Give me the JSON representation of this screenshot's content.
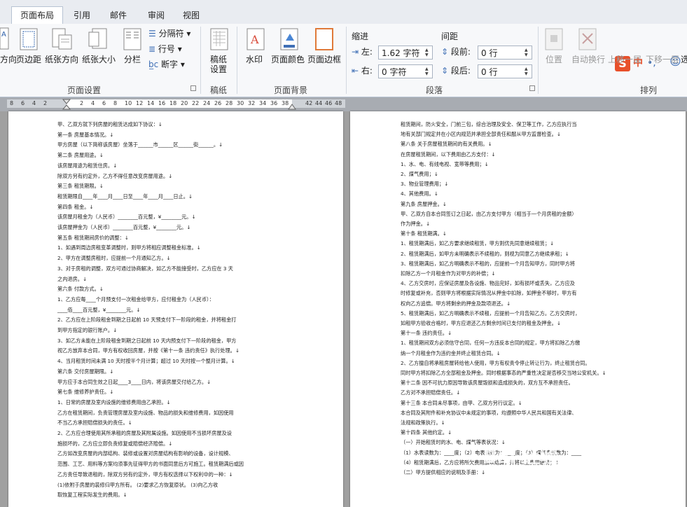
{
  "tabs": [
    {
      "label": "页面布局",
      "active": true
    },
    {
      "label": "引用"
    },
    {
      "label": "邮件"
    },
    {
      "label": "审阅"
    },
    {
      "label": "视图"
    }
  ],
  "page_setup": {
    "direction": "方向",
    "margins": "页边距",
    "orientation": "纸张方向",
    "size": "纸张大小",
    "columns": "分栏",
    "breaks": "分隔符",
    "line_numbers": "行号",
    "hyphenation": "断字",
    "group_label": "页面设置"
  },
  "manuscript": {
    "button": "稿纸\n设置",
    "group_label": "稿纸"
  },
  "background": {
    "watermark": "水印",
    "page_color": "页面颜色",
    "page_border": "页面边框",
    "group_label": "页面背景"
  },
  "paragraph": {
    "indent_title": "缩进",
    "left_label": "左:",
    "left_value": "1.62 字符",
    "right_label": "右:",
    "right_value": "0 字符",
    "spacing_title": "间距",
    "before_label": "段前:",
    "before_value": "0 行",
    "after_label": "段后:",
    "after_value": "0 行",
    "group_label": "段落"
  },
  "arrange": {
    "position": "位置",
    "wrap": "自动换行",
    "bring_forward": "上移一层",
    "send_backward": "下移一层",
    "cut_label": "选",
    "group_label": "排列"
  },
  "ime": {
    "s": "S",
    "zh": "中",
    "p": "•,",
    "smile": "☺"
  },
  "ruler_numbers": [
    "8",
    "6",
    "4",
    "2",
    "2",
    "4",
    "6",
    "8",
    "10",
    "12",
    "14",
    "16",
    "18",
    "20",
    "22",
    "24",
    "26",
    "28",
    "30",
    "32",
    "34",
    "36",
    "38",
    "42",
    "44",
    "46",
    "48"
  ],
  "left_page_lines": [
    "甲、乙双方就下列房屋的租赁达成如下协议：↓",
    "第一条  房屋基本情况。↓",
    "甲方房屋（以下简称该房屋）坐落于______市______区______街______。↓",
    "第二条  房屋用途。↓",
    "该房屋用途为租赁住房。↓",
    "除双方另有约定外，乙方不得任意改变房屋用途。↓",
    "第三条  租赁期限。↓",
    "租赁期限自____年____月____日至____年____月____日止。↓",
    "第四条  租金。↓",
    "该房屋月租金为（人民币）________百元整，¥________元。↓",
    "该房屋押金为（人民币）________百元整，¥________元。↓",
    "第五条  租赁期间房价的调整：↓",
    "1、如遇到周边房租变革调整时，则甲方将相应调整租金标准。↓",
    "2、甲方在调整房租时，应提前一个月通知乙方。↓",
    "3、对于房租的调整，双方可通过协商解决，如乙方不能接受时，乙方应在 3 天",
    "之内退房。↓",
    "第六条  付款方式。↓",
    "1、乙方应每____个月预支付一次租金给甲方，应付租金为（人民币）：",
    "    ____佰____百元整，¥________元。↓",
    "2、乙方应在上阶段租金到期之日起前 10 天预支付下一阶段的租金，并将租金打",
    "到甲方指定的银行账户。↓",
    "3、如乙方未能在上阶段租金到期之日起前 10 天内预支付下一阶段的租金，甲方",
    "视乙方放弃本合同，甲方有权收回房屋，并按《第十一条  违约责任》执行处理。↓",
    "4、当月租赁时间未满 10 天时按半个月计算；超过 10 天时按一个整月计算。↓",
    "第六条  交付房屋期限。↓",
    "甲方应于本合同生效之日起____3____日内，将该房屋交付给乙方。↓",
    "第七条  维修养护责任。↓",
    "1、日常的房屋及室内设施的维修费用由乙承担。↓",
    "乙方在租赁期间，负责管理房屋及室内设施、物品的损失和维修费用，如因使用",
    "不当乙方承担赔偿损失的责任。↓",
    "2、乙方应合理使用其所承租的房屋及其附属设施。如因使用不当损坏房屋及设",
    "施损坏的，乙方应立即负责修复或赔偿经济赔偿。↓",
    "乙方如改变房屋的内部结构、装修或设置对房屋结构有影响的设备，设计规模、",
    "范围、工艺、用料等方案均须事先征得甲方的书面同意后方可施工。租赁期满后或因",
    "乙方责任导致退租的，除双方另有约定外，甲方有权选择以下权利中的一种：↓",
    "    (1)依附于房屋的装修归甲方所有。    (2)要求乙方恢复原状。    (3)向乙方收",
    "取恢复工程实际发生的费用。↓"
  ],
  "right_page_lines": [
    "租赁期间，防火安全，门前三包，综合治理及安全、保卫等工作，乙方应执行当",
    "地有关部门规定并在小区内规范并承担全部责任和服从甲方监督检查。↓",
    "第八条  关于房屋租赁期间的有关费用。↓",
    "在房屋租赁期间，以下费用由乙方支付：↓",
    "1、水、电、有线电视、宽带等费用；↓",
    "2、煤气费用；↓",
    "3、物业管理费用；↓",
    "4、其他费用。↓",
    "第九条  房屋押金。↓",
    "甲、乙双方自本合同签订之日起，由乙方支付甲方（相当于一个月房租的金额）",
    "作为押金。↓",
    "第十条  租赁期满。↓",
    "1、租赁期满后，如乙方要求继续租赁，甲方则优先同意继续租赁；↓",
    "2、租赁期满后，如甲方未明确表示不续租的，则视为同意乙方继续承租；↓",
    "3、租赁期满后，如乙方明确表示不租的，应提前一个月告知甲方，同时甲方将",
    "扣除乙方一个月租金作为对甲方的补偿；↓",
    "4、乙方交房时，应保证房屋及各设施、物品完好，如有损坏或丢失，乙方应及",
    "时修复或补充，否则甲方将根据实际情况从押金中扣除，如押金不够时，甲方有",
    "权向乙方追偿。甲方将剩余的押金及款项退还。↓",
    "5、租赁期满后，如乙方明确表示不续租，应提前一个月告知乙方。乙方交房时，",
    "如租甲方验收合格时，甲方应退还乙方剩余时间已支付的租金及押金。↓",
    "第十一条  违约责任。↓",
    "1、租赁期间双方必须信守合同，任何一方违反本合同的规定，甲方将扣除乙方缴",
    "纳一个月租金作为违约金并终止租赁合同。↓",
    "2、乙方擅自将承租房屋转给他人使用，甲方有权责令停止转让行为，终止租赁合同。",
    "同时甲方将扣除乙方全部租金及押金。同时根据事态的严重性决定是否移交当地公安机关。↓",
    "第十二条  因不可抗力原因导致该房屋毁损和造成损失的，双方互不承担责任。",
    "乙方对不承担赔偿责任。↓",
    "第十三条  本合同未尽事项，由甲、乙双方另行议定。↓",
    "本合同及其附件和补充协议中未规定的事项，均遵照中华人民共和国有关法律、",
    "法规和政策执行。↓",
    "第十四条  其他约定。↓",
    "（一）开始租赁时的水、电、煤气等表状况：↓",
    "  （1）水表读数为：____度；（2）电表读数为：____度；（3）煤气表读数为：____",
    "（4）租赁期满后，乙方应将所欠费用加以结算，并将以上费用缴清；↓",
    "（二）甲方提供相应的说明及手册：↓"
  ],
  "watermark": {
    "main": "Bai 经验",
    "sub": "jingyan.baidu.com"
  }
}
